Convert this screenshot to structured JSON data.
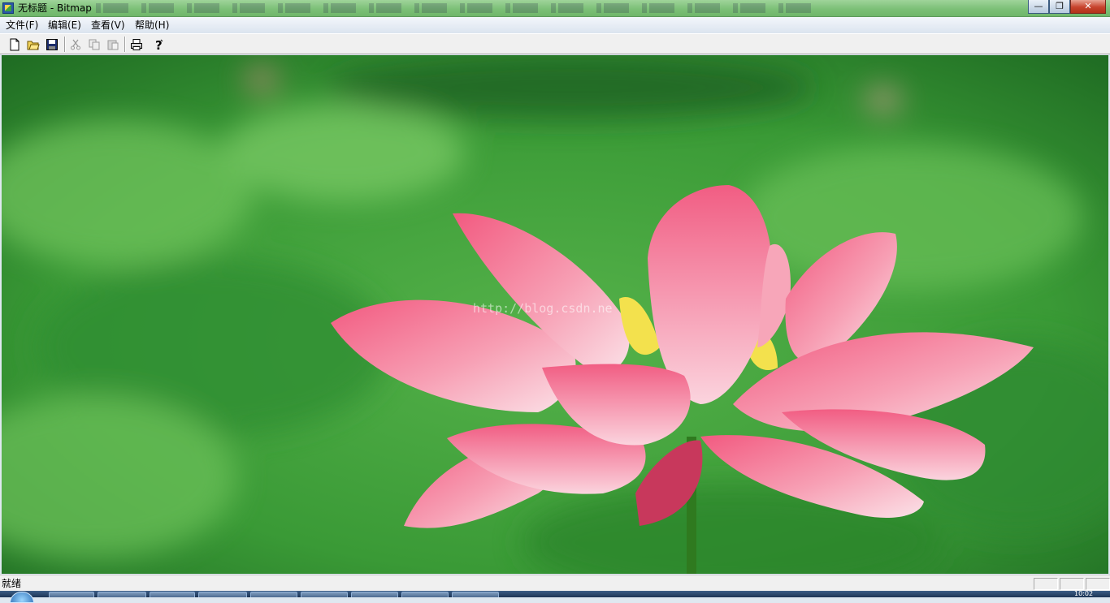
{
  "window": {
    "title": "无标题 - Bitmap",
    "controls": [
      "minimize-icon",
      "restore-icon",
      "close-icon"
    ]
  },
  "menu": {
    "items": [
      {
        "label": "文件(F)"
      },
      {
        "label": "编辑(E)"
      },
      {
        "label": "查看(V)"
      },
      {
        "label": "帮助(H)"
      }
    ]
  },
  "toolbar": {
    "buttons": [
      {
        "icon": "new-file-icon"
      },
      {
        "icon": "open-folder-icon"
      },
      {
        "icon": "save-icon"
      },
      {
        "icon": "cut-icon"
      },
      {
        "icon": "copy-icon"
      },
      {
        "icon": "paste-icon"
      },
      {
        "icon": "print-icon"
      },
      {
        "icon": "help-icon"
      }
    ]
  },
  "canvas": {
    "image": "lotus-flower",
    "watermark": "http://blog.csdn.ne",
    "colors": {
      "background": "#3f9a3a",
      "petal": "#f07a95",
      "center": "#f2e24a"
    }
  },
  "status": {
    "text": "就绪"
  },
  "taskbar": {
    "clock": "10:02"
  }
}
